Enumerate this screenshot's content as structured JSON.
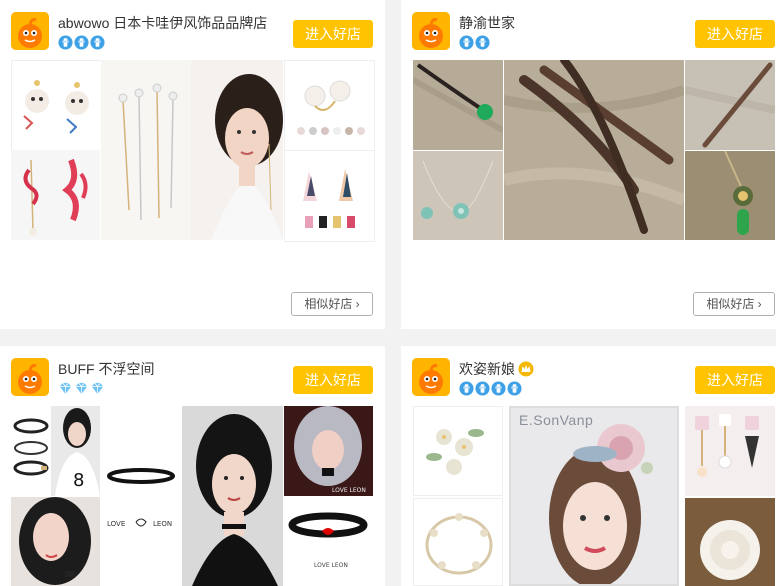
{
  "shops": [
    {
      "name": "abwowo 日本卡哇伊风饰品品牌店",
      "badge_icons": [
        "blue-crown-badge-icon",
        "blue-crown-badge-icon",
        "blue-crown-badge-icon"
      ],
      "enter_label": "进入好店",
      "similar_label": "相似好店 ›",
      "photos": [
        "cat-earrings-photo",
        "long-pin-earrings-photo",
        "model-wearing-earrings-photo",
        "pearl-earrings-photo",
        "red-coral-earrings-photo",
        "tassel-earrings-photo"
      ]
    },
    {
      "name": "静渝世家",
      "badge_icons": [
        "blue-crown-badge-icon",
        "blue-crown-badge-icon"
      ],
      "enter_label": "进入好店",
      "similar_label": "相似好店 ›",
      "photos": [
        "green-jade-hairpin-photo",
        "wooden-hairpins-photo",
        "wooden-stick-hairpin-photo",
        "jade-bead-threader-photo",
        "jade-flower-hairpin-photo"
      ]
    },
    {
      "name": "BUFF 不浮空间",
      "badge_icons": [
        "diamond-badge-icon",
        "diamond-badge-icon",
        "diamond-badge-icon"
      ],
      "enter_label": "进入好店",
      "photos": [
        "choker-set-photo",
        "model-number-eight-shirt-photo",
        "love-leon-choker-photo",
        "model-black-choker-photo",
        "silver-hair-model-photo",
        "model-selfie-photo",
        "heart-choker-photo"
      ]
    },
    {
      "name": "欢姿新娘",
      "crown_icon": "gold-crown-icon",
      "badge_icons": [
        "blue-crown-badge-icon",
        "blue-crown-badge-icon",
        "blue-crown-badge-icon",
        "blue-crown-badge-icon"
      ],
      "enter_label": "进入好店",
      "watermark": "E.SonVanp",
      "photos": [
        "floral-hairpin-photo",
        "bridal-model-flower-headpiece-photo",
        "drop-earrings-photo",
        "leaf-tiara-photo",
        "white-flower-brooch-photo"
      ]
    }
  ]
}
